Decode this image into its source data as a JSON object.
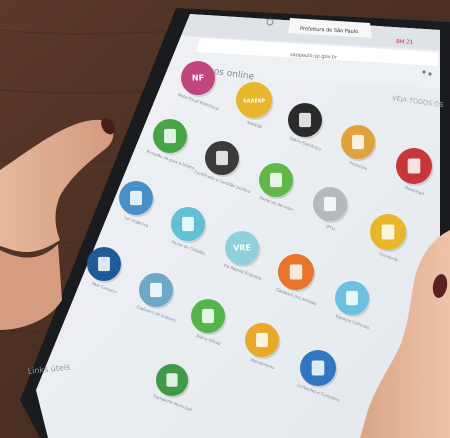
{
  "browser": {
    "tab_title": "Prefeitura de São Paulo",
    "address": "saopaulo.sp.gov.br",
    "tab_badge": "BM 21"
  },
  "page": {
    "section_title": "Serviços online",
    "see_all_link": "VEJA TODOS OS",
    "bottom_section_title": "Links úteis"
  },
  "services": [
    {
      "label": "Nota Fiscal Eletrônica",
      "icon": "nf-icon",
      "color": "#c2467e",
      "badge": "NF"
    },
    {
      "label": "SAAESP",
      "icon": "saaesp-logo-icon",
      "color": "#e8b62a",
      "badge": "SAAESP"
    },
    {
      "label": "Diário Eletrônico",
      "icon": "document-icon",
      "color": "#2b2b2b",
      "badge": ""
    },
    {
      "label": "Protocolo",
      "icon": "clipboard-icon",
      "color": "#e0a23a",
      "badge": ""
    },
    {
      "label": "Download",
      "icon": "cloud-icon",
      "color": "#c9363a",
      "badge": ""
    },
    {
      "label": "Emissão de guia e boleto",
      "icon": "printer-icon",
      "color": "#48a547",
      "badge": ""
    },
    {
      "label": "Certificado e Certidão Jurídica",
      "icon": "certificate-icon",
      "color": "#3b3b3b",
      "badge": ""
    },
    {
      "label": "Portal do Servidor",
      "icon": "server-user-icon",
      "color": "#61b848",
      "badge": ""
    },
    {
      "label": "IPTU",
      "icon": "house-icon",
      "color": "#b5b8bd",
      "badge": ""
    },
    {
      "label": "Ouvidoria",
      "icon": "people-icon",
      "color": "#e8b62a",
      "badge": ""
    },
    {
      "label": "Lei Orgânica",
      "icon": "scales-icon",
      "color": "#4a90c8",
      "badge": ""
    },
    {
      "label": "Portal do Cidadão",
      "icon": "citizen-icon",
      "color": "#5fc0d6",
      "badge": ""
    },
    {
      "label": "Via Rápida Empresa",
      "icon": "business-icon",
      "color": "#8fd0dc",
      "badge": "VRE"
    },
    {
      "label": "Cadastro dos Artistas",
      "icon": "guitar-icon",
      "color": "#e8742a",
      "badge": ""
    },
    {
      "label": "Espaços Culturais",
      "icon": "theater-icon",
      "color": "#6cc0e0",
      "badge": ""
    },
    {
      "label": "Fale Conosco",
      "icon": "location-pin-icon",
      "color": "#1f5a99",
      "badge": ""
    },
    {
      "label": "Cadastro de Imóveis",
      "icon": "clipboard-icon",
      "color": "#6fa7c8",
      "badge": ""
    },
    {
      "label": "Diário Oficial",
      "icon": "newspaper-icon",
      "color": "#53b54a",
      "badge": ""
    },
    {
      "label": "Atendimento",
      "icon": "attendant-icon",
      "color": "#e8a82a",
      "badge": ""
    },
    {
      "label": "Licitações e Contratos",
      "icon": "contract-icon",
      "color": "#2f77c0",
      "badge": ""
    },
    {
      "label": "Transporte Municipal",
      "icon": "bus-icon",
      "color": "#3e9a45",
      "badge": ""
    }
  ]
}
